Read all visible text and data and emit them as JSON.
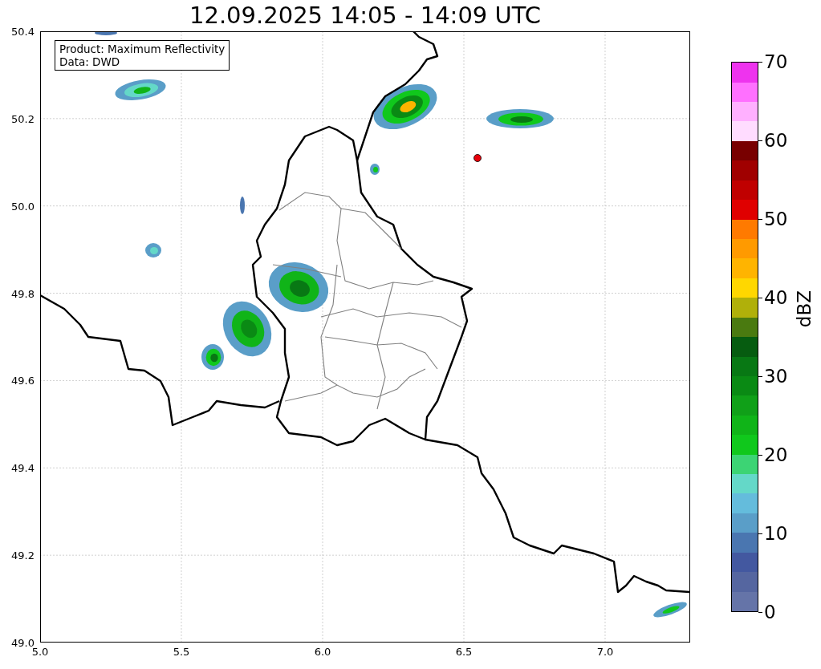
{
  "title": "12.09.2025 14:05 - 14:09 UTC",
  "info_box": {
    "lines": [
      "Product: Maximum Reflectivity",
      "Data: DWD"
    ]
  },
  "map": {
    "y_ticks": [
      "50.4",
      "50.2",
      "50.0",
      "49.8",
      "49.6",
      "49.4",
      "49.2",
      "49.0"
    ],
    "x_ticks": [
      "5.0",
      "5.5",
      "6.0",
      "6.5",
      "7.0"
    ]
  },
  "colorbar": {
    "label": "dBZ",
    "ticks": [
      "70",
      "60",
      "50",
      "40",
      "30",
      "20",
      "10",
      "0"
    ],
    "bins": [
      {
        "color": "#6574a8"
      },
      {
        "color": "#5566a0"
      },
      {
        "color": "#4358a0"
      },
      {
        "color": "#4a76b0"
      },
      {
        "color": "#5a9ec8"
      },
      {
        "color": "#64bcdc"
      },
      {
        "color": "#64d8c8"
      },
      {
        "color": "#3cd474"
      },
      {
        "color": "#10c81c"
      },
      {
        "color": "#10b418"
      },
      {
        "color": "#10a018"
      },
      {
        "color": "#0a8a14"
      },
      {
        "color": "#087814"
      },
      {
        "color": "#065c10"
      },
      {
        "color": "#4a7a10"
      },
      {
        "color": "#b0b00a"
      },
      {
        "color": "#ffd700"
      },
      {
        "color": "#ffb400"
      },
      {
        "color": "#ff9a00"
      },
      {
        "color": "#ff7a00"
      },
      {
        "color": "#e00000"
      },
      {
        "color": "#c00000"
      },
      {
        "color": "#a00000"
      },
      {
        "color": "#780000"
      },
      {
        "color": "#ffdcff"
      },
      {
        "color": "#ffb0ff"
      },
      {
        "color": "#ff70ff"
      },
      {
        "color": "#ee33ee"
      }
    ]
  }
}
